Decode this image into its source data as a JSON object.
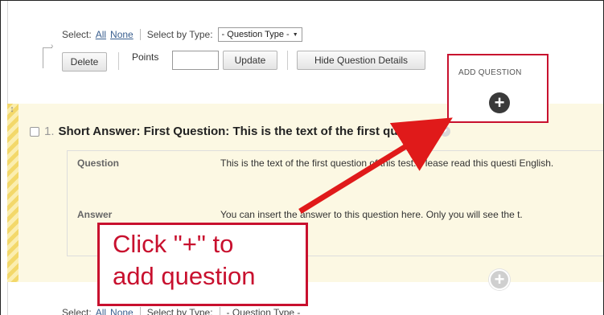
{
  "toolbar": {
    "select_label": "Select:",
    "select_all": "All",
    "select_none": "None",
    "select_by_type_label": "Select by Type:",
    "question_type_value": "- Question Type -",
    "delete_label": "Delete",
    "points_label": "Points",
    "points_value": "",
    "update_label": "Update",
    "hide_details_label": "Hide Question Details"
  },
  "add_question": {
    "label": "ADD QUESTION",
    "plus_glyph": "+"
  },
  "question": {
    "number": "1.",
    "title": "Short Answer: First Question: This is the text of the first questio...",
    "question_label": "Question",
    "question_text": "This is the text of the first question of this test. Please read this questi English.",
    "answer_label": "Answer",
    "answer_text": "You can insert the answer to this question here. Only you will see the t."
  },
  "lower_add": {
    "plus_glyph": "+"
  },
  "bottom_toolbar": {
    "select_label": "Select:",
    "select_all": "All",
    "select_none": "None",
    "select_by_type_label": "Select by Type:",
    "question_type_value": "- Question Type -"
  },
  "callout": {
    "text": "Click \"+\" to\nadd question"
  },
  "colors": {
    "accent_red": "#c8102e",
    "panel_bg": "#fcf8e3",
    "link_blue": "#3a5f8f"
  },
  "icons": {
    "add": "plus-circle-icon",
    "select_caret": "chevron-down-icon",
    "drag": "drag-handle-icon"
  }
}
